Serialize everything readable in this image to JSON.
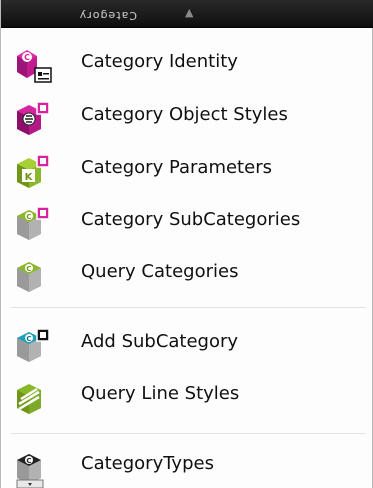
{
  "menu": {
    "title": "Category",
    "items": [
      {
        "label": "Category Identity",
        "icon": "category-identity-icon"
      },
      {
        "label": "Category Object Styles",
        "icon": "category-object-styles-icon"
      },
      {
        "label": "Category Parameters",
        "icon": "category-parameters-icon"
      },
      {
        "label": "Category SubCategories",
        "icon": "category-subcategories-icon"
      },
      {
        "label": "Query Categories",
        "icon": "query-categories-icon"
      },
      {
        "label": "Add SubCategory",
        "icon": "add-subcategory-icon"
      },
      {
        "label": "Query Line Styles",
        "icon": "query-line-styles-icon"
      },
      {
        "label": "CategoryTypes",
        "icon": "category-types-icon"
      }
    ]
  },
  "colors": {
    "title_bar": "#1a1a1a",
    "green": "#8ab82b",
    "magenta": "#d6249e",
    "teal": "#1aa0b8",
    "gray": "#bdbdbd",
    "black": "#111111"
  }
}
